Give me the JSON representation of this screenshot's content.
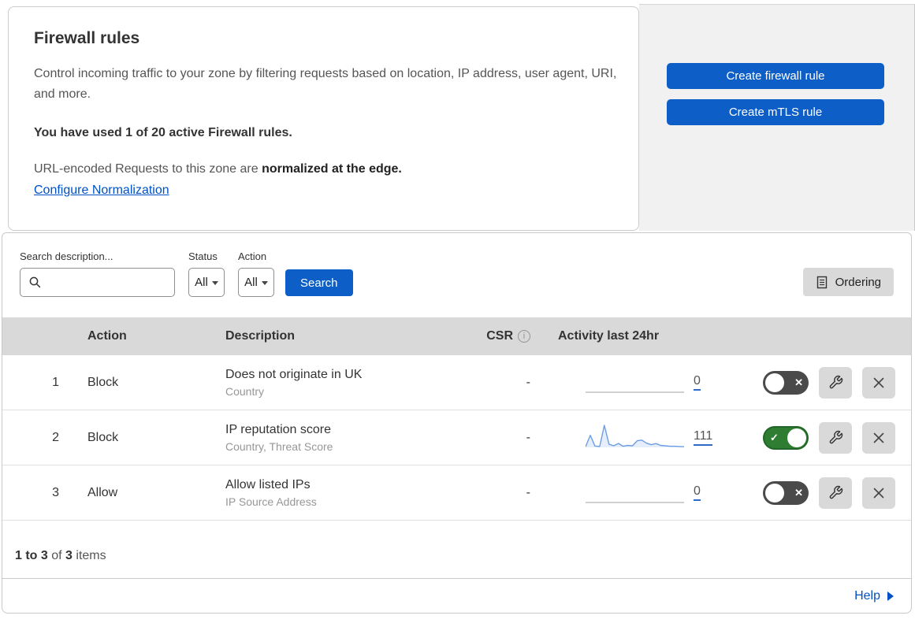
{
  "header": {
    "title": "Firewall rules",
    "description": "Control incoming traffic to your zone by filtering requests based on location, IP address, user agent, URI, and more.",
    "usage": "You have used 1 of 20 active Firewall rules.",
    "normalization_text": "URL-encoded Requests to this zone are ",
    "normalization_bold": "normalized at the edge.",
    "normalization_link": "Configure Normalization",
    "create_firewall_button": "Create firewall rule",
    "create_mtls_button": "Create mTLS rule"
  },
  "filters": {
    "search_label": "Search description...",
    "search_value": "",
    "status_label": "Status",
    "status_value": "All",
    "action_label": "Action",
    "action_value": "All",
    "search_button": "Search",
    "ordering_button": "Ordering"
  },
  "table": {
    "columns": {
      "action": "Action",
      "description": "Description",
      "csr": "CSR",
      "activity": "Activity last 24hr"
    },
    "rows": [
      {
        "index": "1",
        "action": "Block",
        "description": "Does not originate in UK",
        "criteria": "Country",
        "csr": "-",
        "activity_count": "0",
        "enabled": false,
        "sparkline": []
      },
      {
        "index": "2",
        "action": "Block",
        "description": "IP reputation score",
        "criteria": "Country, Threat Score",
        "csr": "-",
        "activity_count": "111",
        "enabled": true,
        "sparkline": [
          3,
          55,
          6,
          4,
          100,
          14,
          7,
          18,
          5,
          9,
          7,
          30,
          33,
          19,
          12,
          17,
          9,
          7,
          5,
          5,
          4,
          3
        ]
      },
      {
        "index": "3",
        "action": "Allow",
        "description": "Allow listed IPs",
        "criteria": "IP Source Address",
        "csr": "-",
        "activity_count": "0",
        "enabled": false,
        "sparkline": []
      }
    ]
  },
  "footer": {
    "range": "1 to 3",
    "of": "of",
    "total": "3",
    "items": "items",
    "help": "Help"
  },
  "colors": {
    "blue_button": "#0d5fc7",
    "link": "#0051c3",
    "toggle_on": "#2e7d33",
    "toggle_off": "#4a4a4a",
    "sparkline": "#6d9ee3",
    "sparkline_fill": "rgba(109,158,227,0.18)",
    "flat_line": "#b5b5b5",
    "table_header_bg": "#d9d9d9",
    "panel_bg": "#f1f1f1"
  }
}
